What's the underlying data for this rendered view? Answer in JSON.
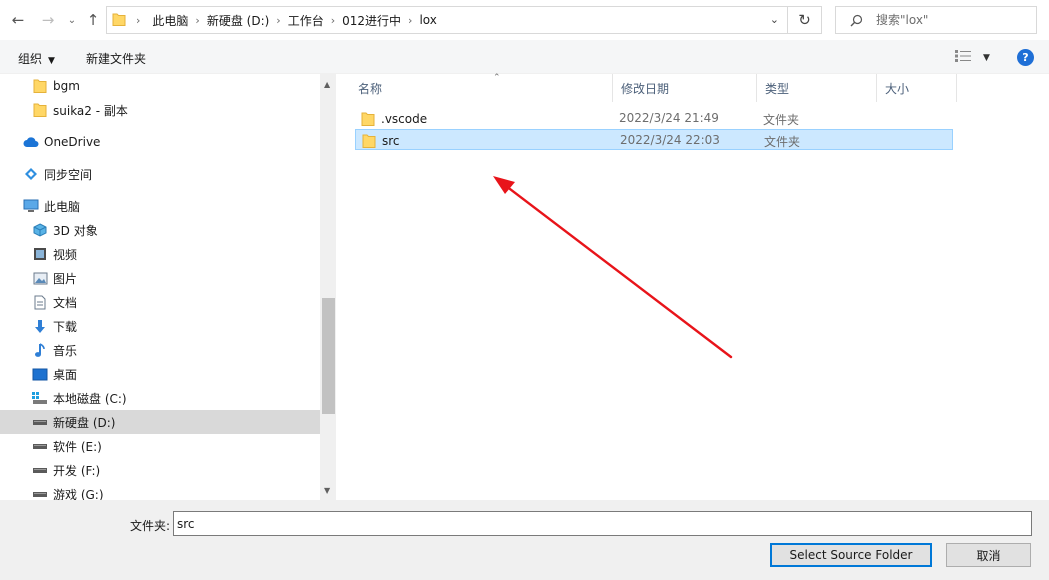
{
  "nav": {
    "back_icon": "back-arrow-icon",
    "forward_icon": "forward-arrow-icon",
    "recent_icon": "chevron-down-icon",
    "up_icon": "up-arrow-icon"
  },
  "address": {
    "crumbs": [
      "此电脑",
      "新硬盘 (D:)",
      "工作台",
      "012进行中",
      "lox"
    ]
  },
  "search": {
    "placeholder": "搜索\"lox\""
  },
  "toolbar": {
    "organize_label": "组织",
    "new_folder_label": "新建文件夹"
  },
  "sidebar": {
    "items": [
      {
        "label": "bgm",
        "icon": "folder-icon"
      },
      {
        "label": "suika2 - 副本",
        "icon": "folder-icon"
      },
      {
        "label": "OneDrive",
        "icon": "cloud-icon"
      },
      {
        "label": "同步空间",
        "icon": "sync-icon"
      },
      {
        "label": "此电脑",
        "icon": "computer-icon"
      },
      {
        "label": "3D 对象",
        "icon": "cube-icon"
      },
      {
        "label": "视频",
        "icon": "video-icon"
      },
      {
        "label": "图片",
        "icon": "picture-icon"
      },
      {
        "label": "文档",
        "icon": "document-icon"
      },
      {
        "label": "下载",
        "icon": "download-icon"
      },
      {
        "label": "音乐",
        "icon": "music-icon"
      },
      {
        "label": "桌面",
        "icon": "desktop-icon"
      },
      {
        "label": "本地磁盘 (C:)",
        "icon": "drive-icon"
      },
      {
        "label": "新硬盘 (D:)",
        "icon": "drive-icon"
      },
      {
        "label": "软件 (E:)",
        "icon": "drive-icon"
      },
      {
        "label": "开发 (F:)",
        "icon": "drive-icon"
      },
      {
        "label": "游戏 (G:)",
        "icon": "drive-icon"
      }
    ]
  },
  "columns": {
    "name": "名称",
    "date": "修改日期",
    "type": "类型",
    "size": "大小"
  },
  "files": [
    {
      "name": ".vscode",
      "date": "2022/3/24 21:49",
      "type": "文件夹"
    },
    {
      "name": "src",
      "date": "2022/3/24 22:03",
      "type": "文件夹"
    }
  ],
  "footer": {
    "folder_label": "文件夹:",
    "folder_value": "src",
    "select_label": "Select Source Folder",
    "cancel_label": "取消"
  },
  "colors": {
    "selection_bg": "#cce8ff",
    "annotation_arrow": "#e8141a",
    "help_blue": "#1f6fd6"
  }
}
